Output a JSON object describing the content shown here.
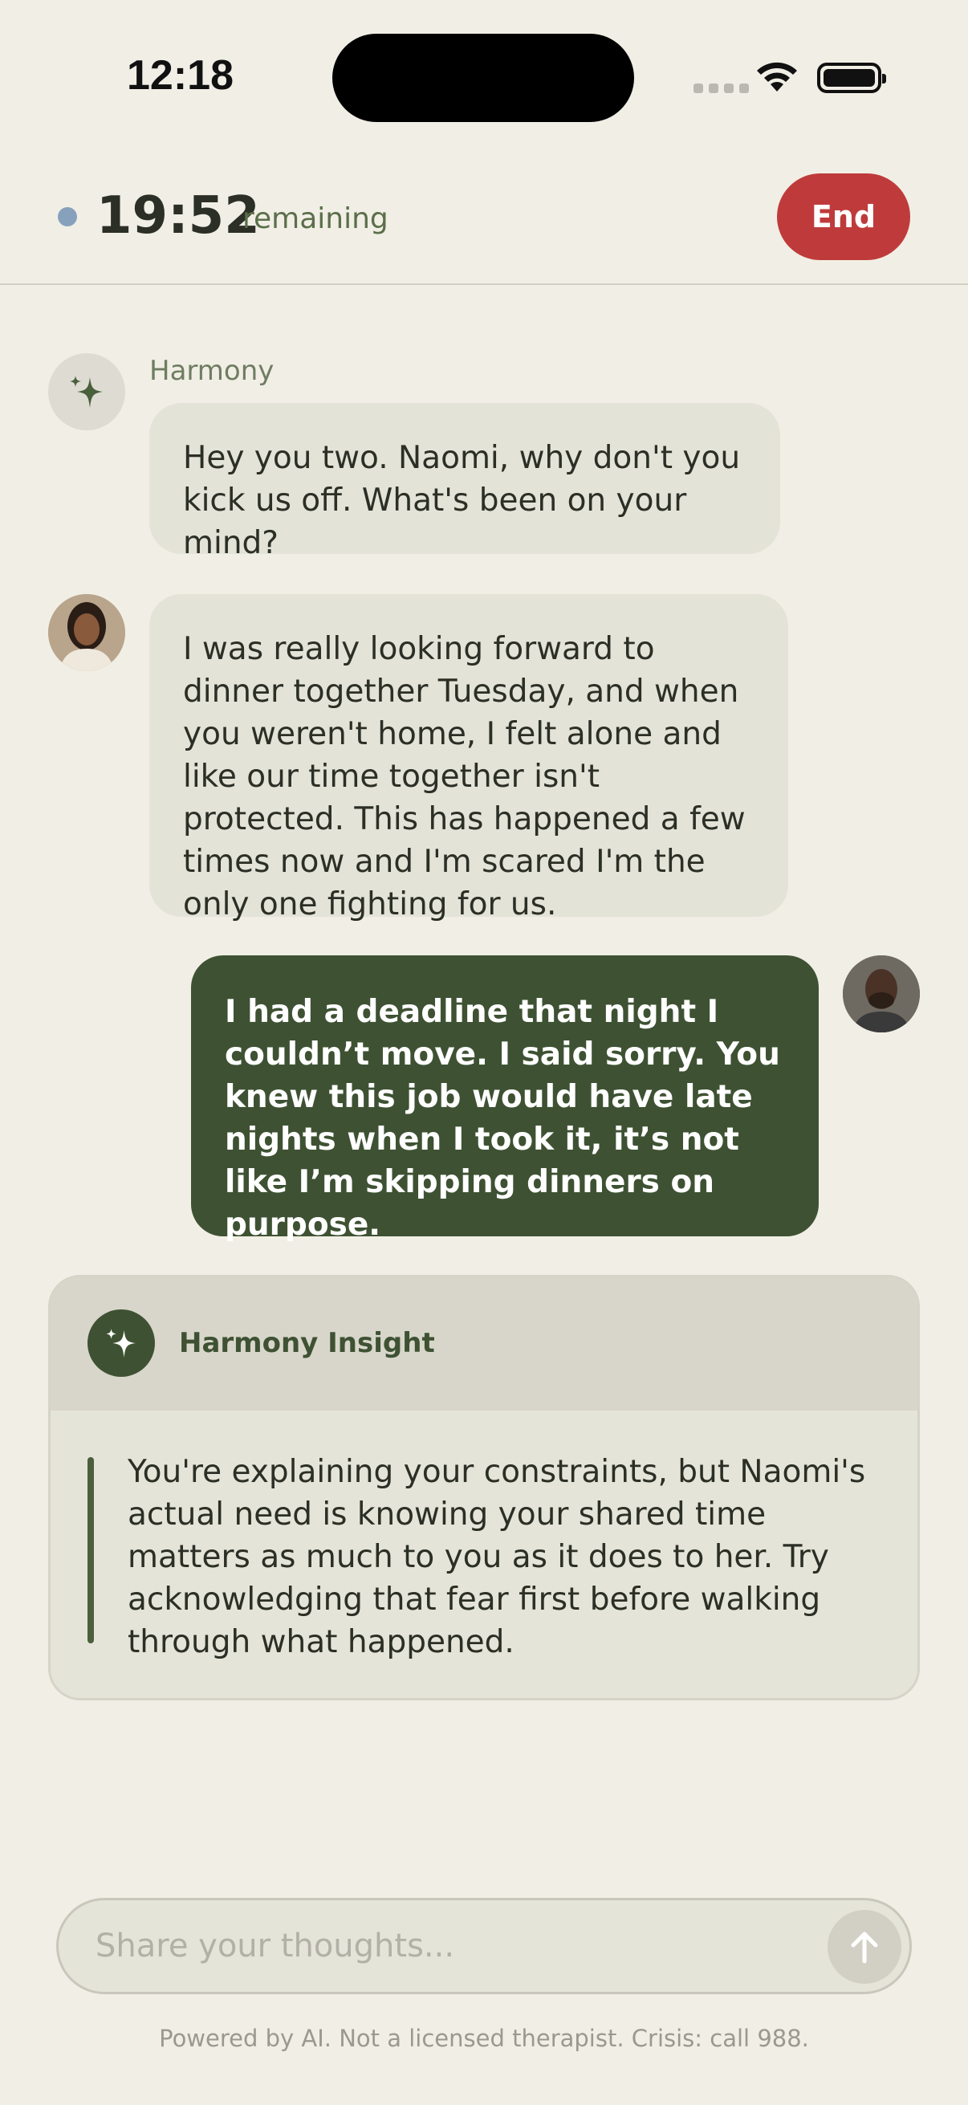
{
  "status_bar": {
    "time": "12:18"
  },
  "header": {
    "timer": "19:52",
    "remaining_label": "remaining",
    "end_label": "End"
  },
  "messages": [
    {
      "sender": "Harmony",
      "text": "Hey you two. Naomi, why don't you kick us off. What's been on your mind?"
    },
    {
      "sender": "",
      "text": "I was really looking forward to dinner together Tuesday, and when you weren't home, I felt alone and like our time together isn't protected. This has happened a few times now and I'm scared I'm the only one fighting for us."
    },
    {
      "sender": "",
      "text": "I had a deadline that night I couldn’t move. I said sorry. You knew this job would have late nights when I took it, it’s not like I’m skipping dinners on purpose."
    }
  ],
  "insight": {
    "title": "Harmony Insight",
    "text": "You're explaining your constraints, but Naomi's actual need is knowing your shared time matters as much to you as it does to her. Try acknowledging that fear first before walking through what happened."
  },
  "composer": {
    "placeholder": "Share your thoughts..."
  },
  "footer": {
    "disclaimer": "Powered by AI. Not a licensed therapist. Crisis: call 988."
  },
  "colors": {
    "accent_green": "#3e5233",
    "end_red": "#bf3b3b",
    "background": "#f1efe5",
    "bubble": "#e4e3d8"
  },
  "icons": [
    "sparkle-icon",
    "avatar-naomi",
    "avatar-partner",
    "arrow-up-icon",
    "wifi-icon",
    "battery-icon"
  ]
}
